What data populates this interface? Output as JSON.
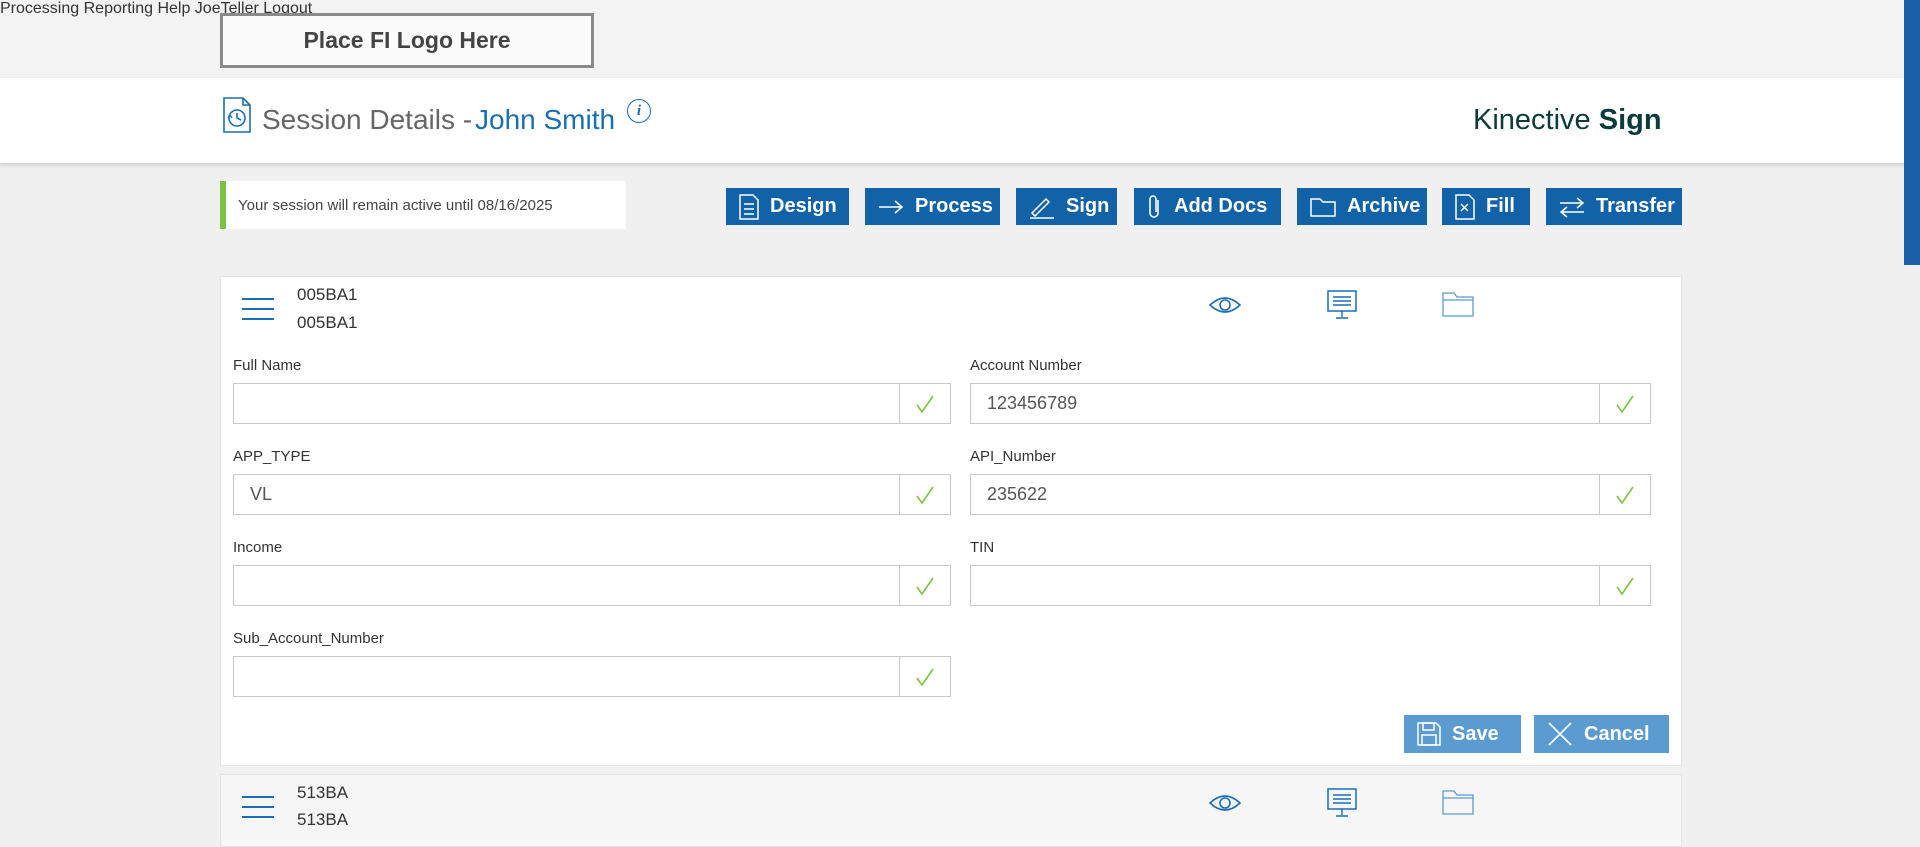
{
  "topbar": {
    "logo_text": "Place FI Logo Here",
    "nav": [
      "Processing",
      "Reporting",
      "Help",
      "JoeTeller",
      "Logout"
    ]
  },
  "header": {
    "title": "Session Details -",
    "customer_name": "John Smith",
    "info_icon": "i",
    "brand_light": "Kinective",
    "brand_bold": "Sign"
  },
  "session_note": "Your session will remain active until 08/16/2025",
  "actions": [
    "Design",
    "Process",
    "Sign",
    "Add Docs",
    "Archive",
    "Fill",
    "Transfer"
  ],
  "documents": [
    {
      "id_line1": "005BA1",
      "id_line2": "005BA1",
      "fields": [
        {
          "label": "Full Name",
          "value": ""
        },
        {
          "label": "Account Number",
          "value": "123456789"
        },
        {
          "label": "APP_TYPE",
          "value": "VL"
        },
        {
          "label": "API_Number",
          "value": "235622"
        },
        {
          "label": "Income",
          "value": ""
        },
        {
          "label": "TIN",
          "value": ""
        },
        {
          "label": "Sub_Account_Number",
          "value": ""
        }
      ],
      "save_label": "Save",
      "cancel_label": "Cancel"
    },
    {
      "id_line1": "513BA",
      "id_line2": "513BA"
    }
  ],
  "colors": {
    "accent_blue": "#1262a8",
    "link_blue": "#1a6eb4",
    "check_green": "#7dc242",
    "secondary_button": "#5b9bd0"
  }
}
